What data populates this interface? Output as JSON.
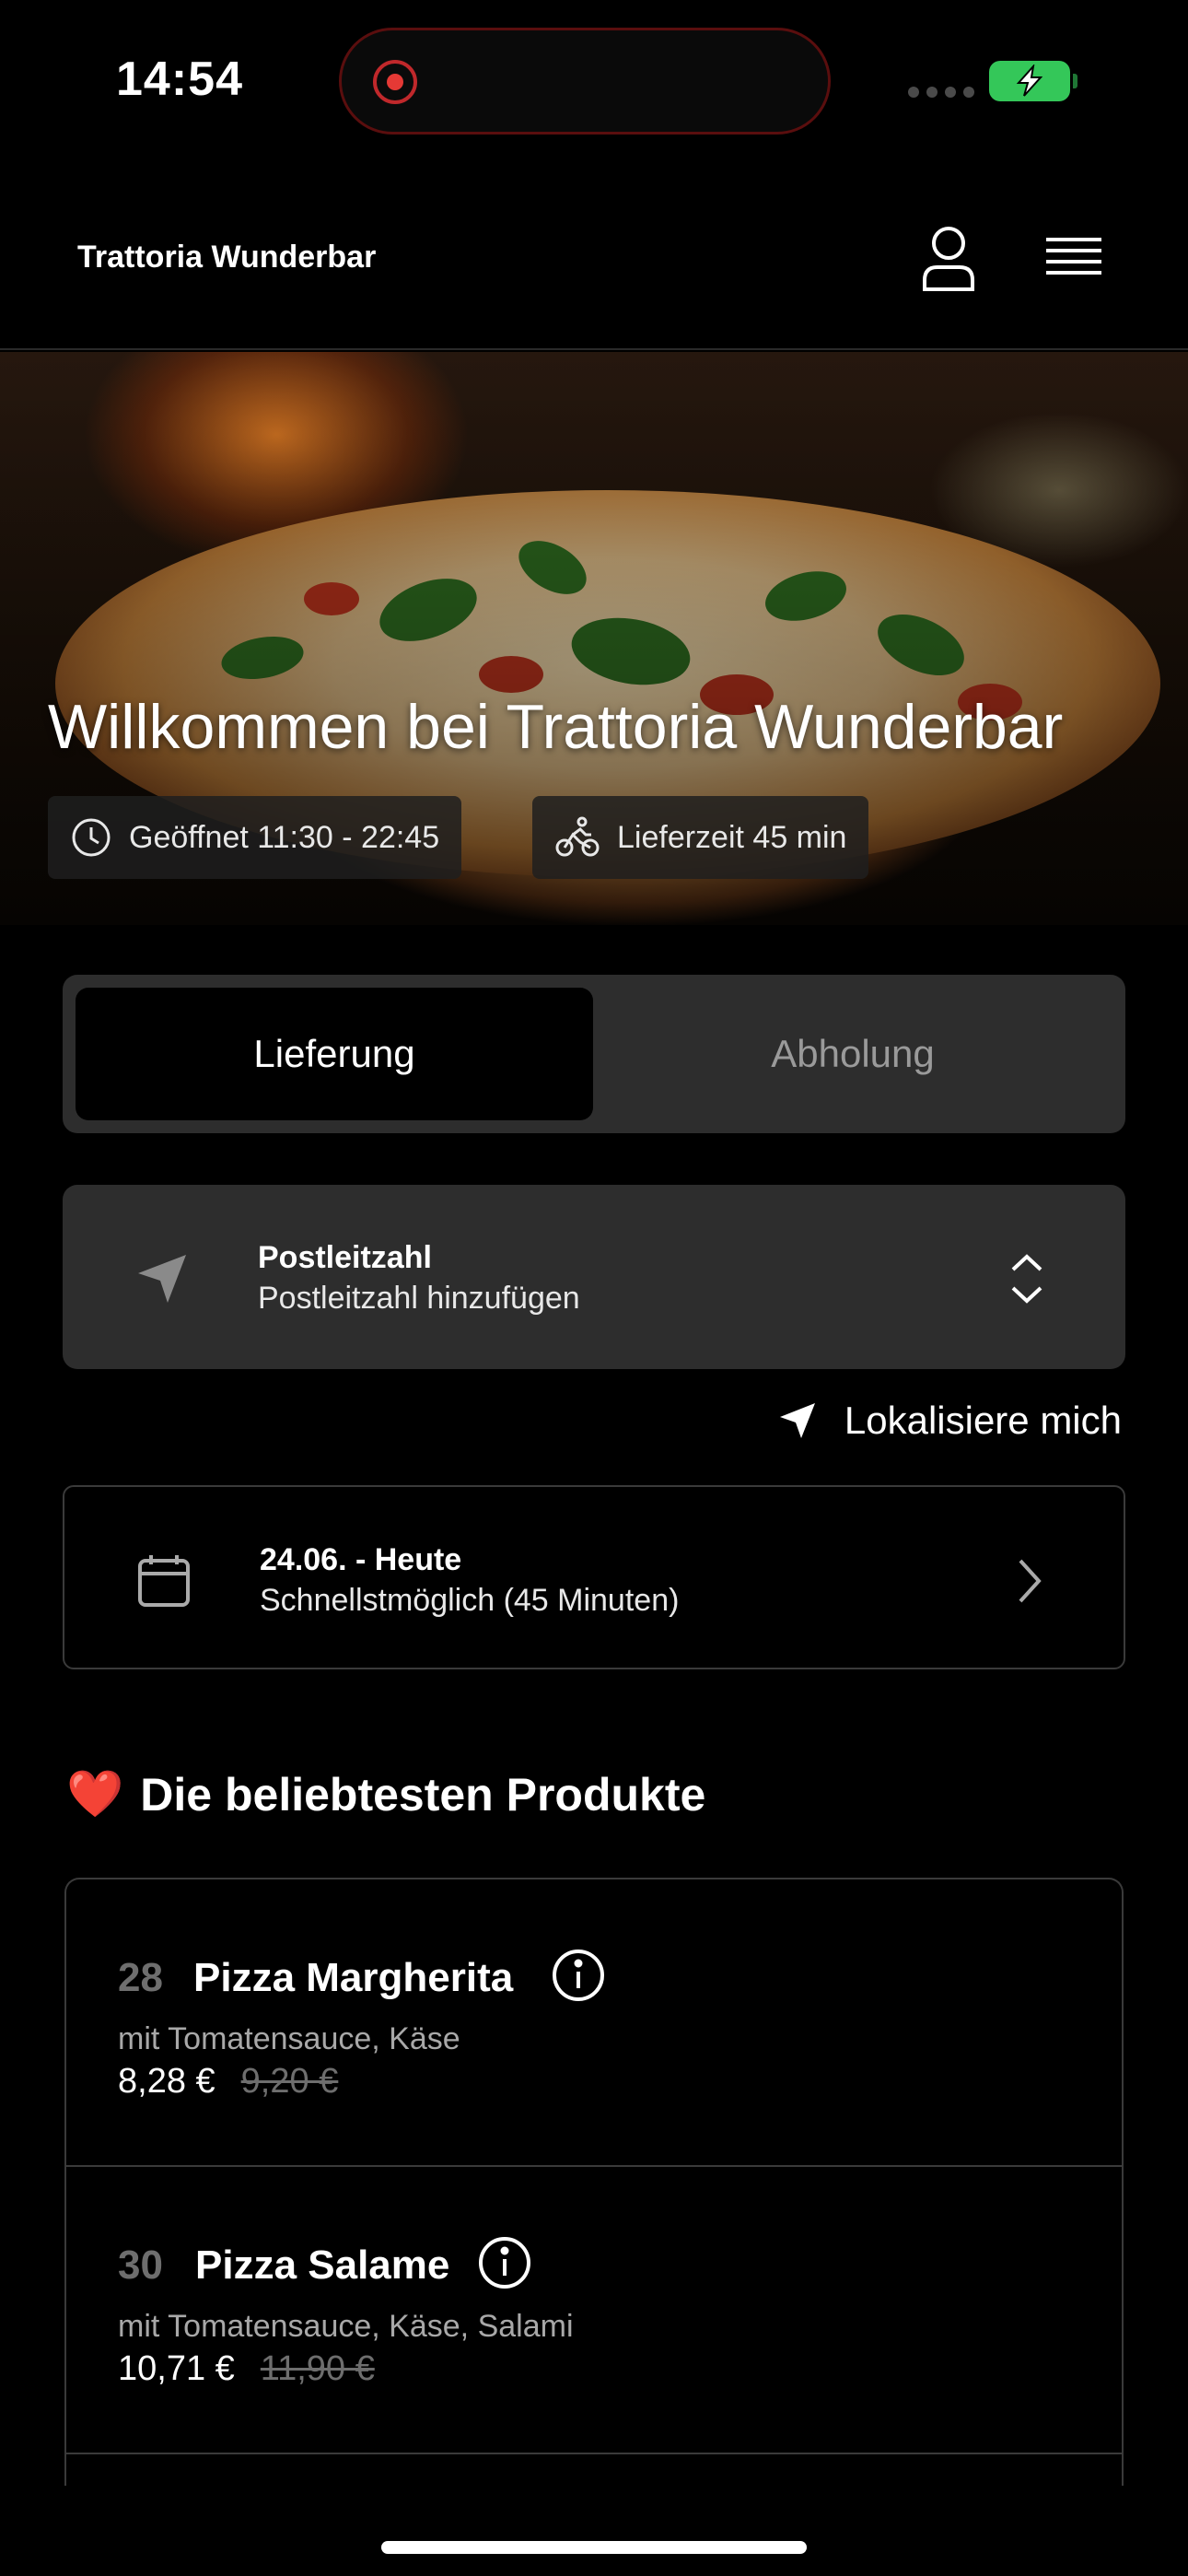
{
  "status_bar": {
    "time": "14:54"
  },
  "header": {
    "brand": "Trattoria Wunderbar"
  },
  "hero": {
    "title": "Willkommen bei Trattoria Wunderbar",
    "hours": "Geöffnet 11:30 - 22:45",
    "delivery_time": "Lieferzeit 45 min"
  },
  "toggle": {
    "delivery": "Lieferung",
    "pickup": "Abholung",
    "selected": "Lieferung"
  },
  "postal": {
    "title": "Postleitzahl",
    "placeholder": "Postleitzahl hinzufügen"
  },
  "locate": {
    "label": "Lokalisiere mich"
  },
  "date": {
    "title": "24.06. - Heute",
    "subtitle": "Schnellstmöglich (45 Minuten)"
  },
  "popular": {
    "emoji": "❤️",
    "title": "Die beliebtesten Produkte",
    "items": [
      {
        "number": "28",
        "name": "Pizza Margherita",
        "description": "mit Tomatensauce, Käse",
        "price": "8,28 €",
        "old_price": "9,20 €"
      },
      {
        "number": "30",
        "name": "Pizza Salame",
        "description": "mit Tomatensauce, Käse, Salami",
        "price": "10,71 €",
        "old_price": "11,90 €"
      }
    ]
  },
  "colors": {
    "background": "#000000",
    "card": "#2d2d2d",
    "battery": "#34c759",
    "recording": "#e53935"
  }
}
